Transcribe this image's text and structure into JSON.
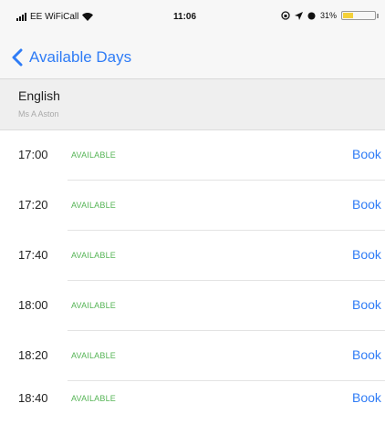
{
  "status_bar": {
    "carrier": "EE WiFiCall",
    "time": "11:06",
    "battery_percent": "31%",
    "battery_level": 0.31,
    "battery_color": "#f4d13a",
    "icons": [
      "signal-icon",
      "wifi-icon",
      "lock-rotation-icon",
      "location-icon",
      "alarm-icon",
      "battery-icon"
    ]
  },
  "nav": {
    "back_label": "Available Days",
    "accent": "#2f7cf6"
  },
  "section": {
    "subject": "English",
    "teacher": "Ms A Aston"
  },
  "slots": [
    {
      "time": "17:00",
      "status": "AVAILABLE",
      "action": "Book"
    },
    {
      "time": "17:20",
      "status": "AVAILABLE",
      "action": "Book"
    },
    {
      "time": "17:40",
      "status": "AVAILABLE",
      "action": "Book"
    },
    {
      "time": "18:00",
      "status": "AVAILABLE",
      "action": "Book"
    },
    {
      "time": "18:20",
      "status": "AVAILABLE",
      "action": "Book"
    },
    {
      "time": "18:40",
      "status": "AVAILABLE",
      "action": "Book"
    }
  ],
  "colors": {
    "available": "#55b455"
  }
}
